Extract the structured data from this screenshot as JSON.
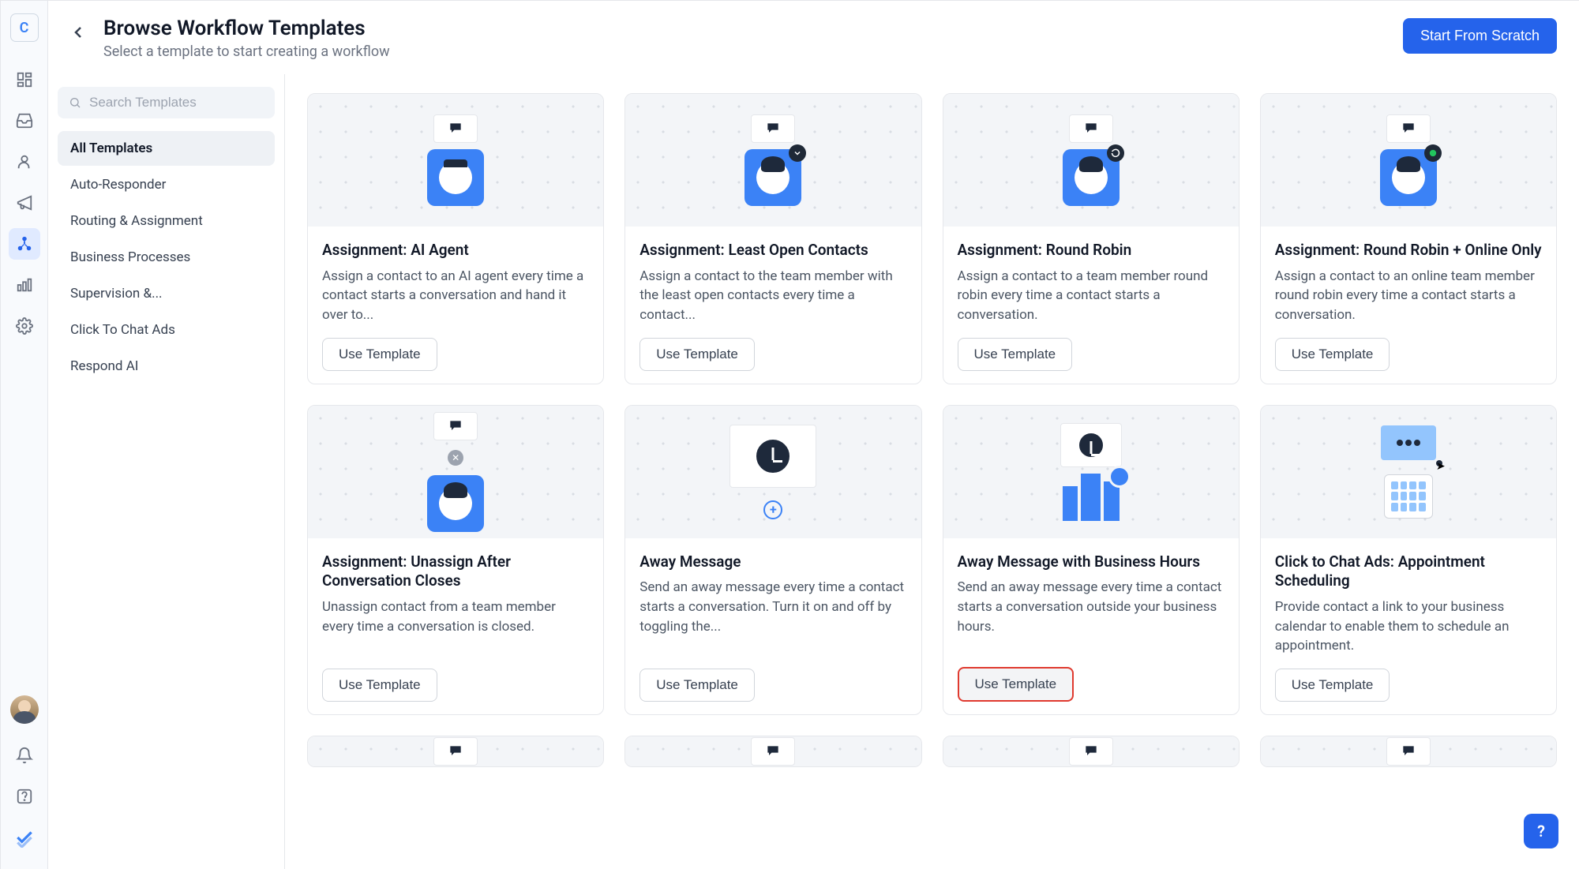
{
  "rail": {
    "logo": "C"
  },
  "header": {
    "title": "Browse Workflow Templates",
    "subtitle": "Select a template to start creating a workflow",
    "start_button": "Start From Scratch"
  },
  "search": {
    "placeholder": "Search Templates"
  },
  "categories": [
    {
      "label": "All Templates",
      "active": true
    },
    {
      "label": "Auto-Responder",
      "active": false
    },
    {
      "label": "Routing & Assignment",
      "active": false
    },
    {
      "label": "Business Processes",
      "active": false
    },
    {
      "label": "Supervision &...",
      "active": false
    },
    {
      "label": "Click To Chat Ads",
      "active": false
    },
    {
      "label": "Respond AI",
      "active": false
    }
  ],
  "use_template_label": "Use Template",
  "cards": [
    {
      "title": "Assignment: AI Agent",
      "desc": "Assign a contact to an AI agent every time a contact starts a conversation and hand it over to..."
    },
    {
      "title": "Assignment: Least Open Contacts",
      "desc": "Assign a contact to the team member with the least open contacts every time a contact..."
    },
    {
      "title": "Assignment: Round Robin",
      "desc": "Assign a contact to a team member round robin every time a contact starts a conversation."
    },
    {
      "title": "Assignment: Round Robin + Online Only",
      "desc": "Assign a contact to an online team member round robin every time a contact starts a conversation."
    },
    {
      "title": "Assignment: Unassign After Conversation Closes",
      "desc": "Unassign contact from a team member every time a conversation is closed."
    },
    {
      "title": "Away Message",
      "desc": "Send an away message every time a contact starts a conversation. Turn it on and off by toggling the..."
    },
    {
      "title": "Away Message with Business Hours",
      "desc": "Send an away message every time a contact starts a conversation outside your business hours."
    },
    {
      "title": "Click to Chat Ads: Appointment Scheduling",
      "desc": "Provide contact a link to your business calendar to enable them to schedule an appointment."
    }
  ],
  "help_fab": "?"
}
